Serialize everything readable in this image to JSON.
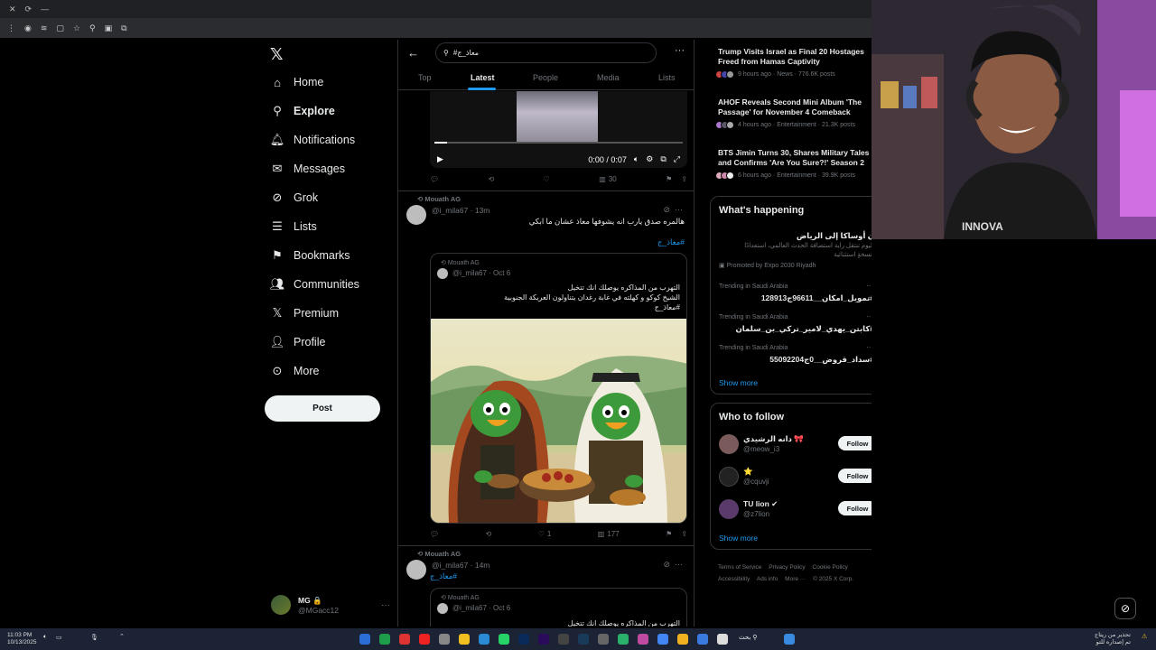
{
  "browser": {
    "window_controls": [
      "✕",
      "⟳",
      "—"
    ]
  },
  "left_nav": {
    "items": [
      {
        "label": "Home",
        "icon": "home-icon"
      },
      {
        "label": "Explore",
        "icon": "search-icon",
        "active": true
      },
      {
        "label": "Notifications",
        "icon": "bell-icon"
      },
      {
        "label": "Messages",
        "icon": "envelope-icon"
      },
      {
        "label": "Grok",
        "icon": "grok-icon"
      },
      {
        "label": "Lists",
        "icon": "list-icon"
      },
      {
        "label": "Bookmarks",
        "icon": "bookmark-icon"
      },
      {
        "label": "Communities",
        "icon": "people-icon"
      },
      {
        "label": "Premium",
        "icon": "x-logo-icon"
      },
      {
        "label": "Profile",
        "icon": "person-icon"
      },
      {
        "label": "More",
        "icon": "more-circle-icon"
      }
    ],
    "post_label": "Post",
    "account": {
      "name": "MG 🔒",
      "handle": "@MGacc12"
    }
  },
  "search": {
    "query": "#معاذ_ج",
    "tabs": [
      "Top",
      "Latest",
      "People",
      "Media",
      "Lists"
    ],
    "active_tab": "Latest"
  },
  "video": {
    "time": "0:00 / 0:07"
  },
  "tweet1_actions": {
    "views": "30"
  },
  "tweet2": {
    "repost_by": "Mouath AG",
    "handle_time": "@i_mila67 · 13m",
    "text": "هالمره صدق يارب انه يشوفها معاذ عشان ما ابكي",
    "hashtag": "#معاذ_ج",
    "quote": {
      "repost_by": "Mouath AG",
      "handle_time": "@i_mila67 · Oct 6",
      "line1": "التهرب من المذاكره يوصلك انك تتخيل",
      "line2": "الشيخ كوكو و كهلته في غابة رغدان يتناولون العريكة الجنوبية",
      "line3": "#معاذ_ج"
    },
    "likes": "1",
    "views": "177"
  },
  "tweet3": {
    "repost_by": "Mouath AG",
    "handle_time": "@i_mila67 · 14m",
    "hashtag": "#معاذ_ج",
    "quote": {
      "repost_by": "Mouath AG",
      "handle_time": "@i_mila67 · Oct 6",
      "line1": "التهرب من المذاكره يوصلك انك تتخيل"
    }
  },
  "news": [
    {
      "title": "Trump Visits Israel as Final 20 Hostages Freed from Hamas Captivity",
      "meta": "9 hours ago · News · 776.6K posts"
    },
    {
      "title": "AHOF Reveals Second Mini Album 'The Passage' for November 4 Comeback",
      "meta": "4 hours ago · Entertainment · 21.3K posts"
    },
    {
      "title": "BTS Jimin Turns 30, Shares Military Tales and Confirms 'Are You Sure?!' Season 2",
      "meta": "6 hours ago · Entertainment · 39.9K posts"
    }
  ],
  "whats_happening": {
    "title": "What's happening",
    "promo_title": "ن أوساكا إلى الرياض",
    "promo_text1": "اليوم تنتقل راية استضافة الحدث العالمي، استعدادًا",
    "promo_text2": "لنسخةٍ استثنائية",
    "promo_by": "Promoted by Expo 2030 Riyadh",
    "trends": [
      {
        "category": "Trending in Saudi Arabia",
        "name": "#تمويل_امكان__96611ج128913"
      },
      {
        "category": "Trending in Saudi Arabia",
        "name": "#كابتن_يهدي_لامير_تركي_بن_سلمان"
      },
      {
        "category": "Trending in Saudi Arabia",
        "name": "#سداد_قروض__0ج55092204"
      }
    ],
    "show_more": "Show more"
  },
  "who_to_follow": {
    "title": "Who to follow",
    "users": [
      {
        "name": "دانه الرشيدي 🎀",
        "handle": "@meow_i3",
        "avatar_color": "#7a5a5a"
      },
      {
        "name": "⭐",
        "handle": "@cquvji",
        "avatar_color": "#222222"
      },
      {
        "name": "TU lion ✔",
        "handle": "@z7lion",
        "avatar_color": "#5a3a6a"
      }
    ],
    "follow_label": "Follow",
    "show_more": "Show more"
  },
  "footer": [
    "Terms of Service",
    "Privacy Policy",
    "Cookie Policy",
    "Accessibility",
    "Ads info",
    "More ···",
    "© 2025 X Corp."
  ],
  "taskbar": {
    "time": "11:03 PM",
    "date": "10/13/2025",
    "search_label": "بحث",
    "notice1": "تحذير من ريتاج",
    "notice2": "تم إصداره للتو"
  },
  "colors": {
    "accent": "#1d9bf0",
    "bg": "#000000",
    "border": "#2f3336"
  }
}
